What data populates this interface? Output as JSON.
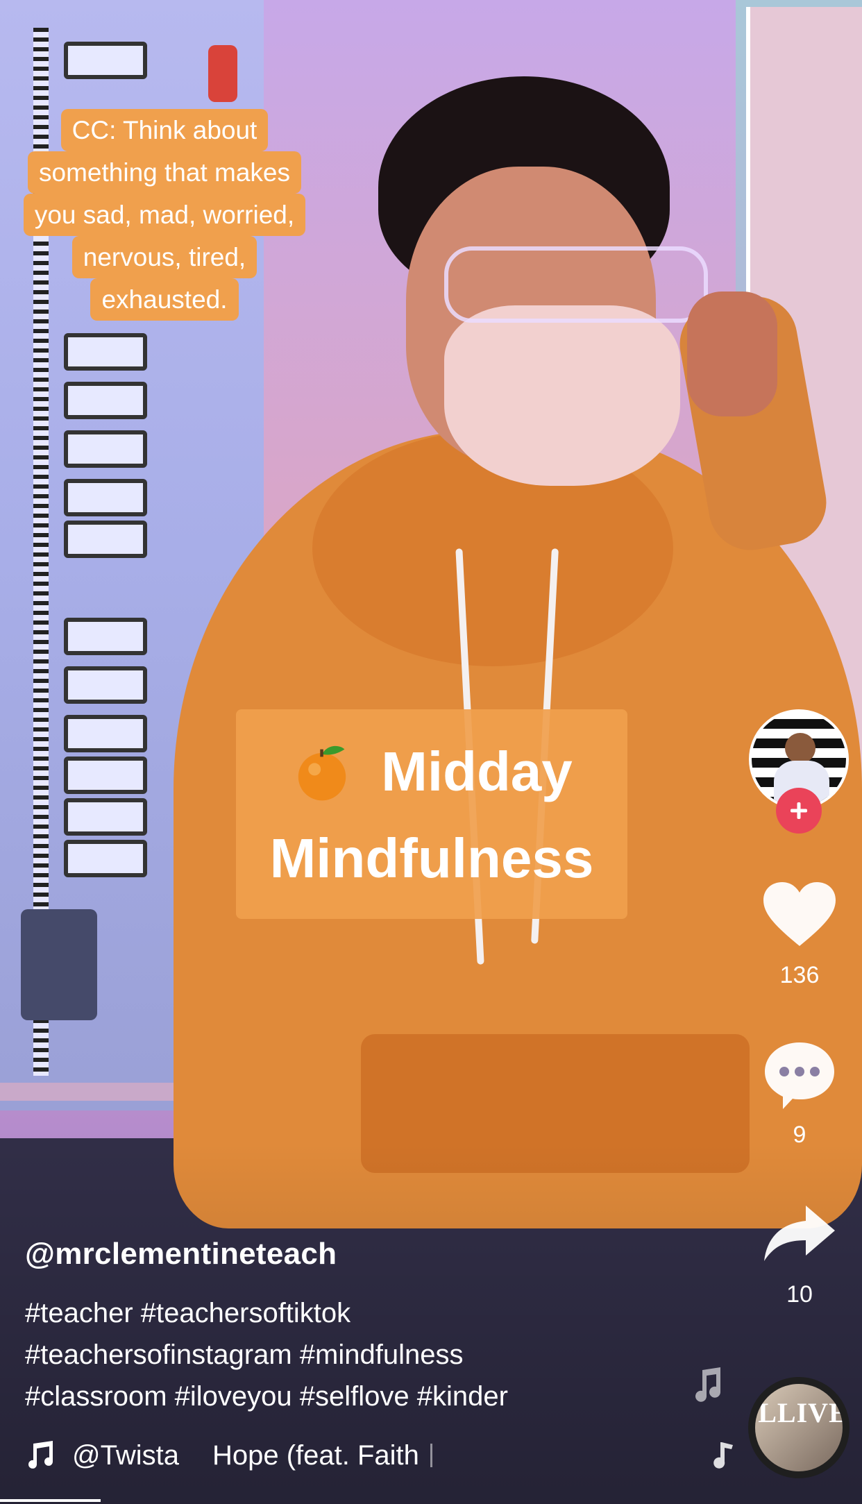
{
  "caption_overlay": {
    "lines": [
      "CC: Think about",
      "something that makes",
      "you sad, mad, worried,",
      "nervous, tired,",
      "exhausted."
    ]
  },
  "title_overlay": {
    "emoji": "orange",
    "line1": "Midday",
    "line2": "Mindfulness"
  },
  "actions": {
    "likes": "136",
    "comments": "9",
    "shares": "10"
  },
  "post": {
    "username": "@mrclementineteach",
    "hashtags": [
      "#teacher #teachersoftiktok",
      "#teachersofinstagram #mindfulness",
      "#classroom #iloveyou #selflove #kinder"
    ]
  },
  "music": {
    "artist": "@Twista",
    "track": "Hope (feat. Faith",
    "disc_label": "LLIVE"
  },
  "colors": {
    "caption_bg": "#f0a04d",
    "follow_button": "#ea4359",
    "text": "#ffffff"
  },
  "icons": [
    "heart-icon",
    "comment-bubble-icon",
    "share-arrow-icon",
    "music-note-icon",
    "plus-icon",
    "orange-icon"
  ]
}
